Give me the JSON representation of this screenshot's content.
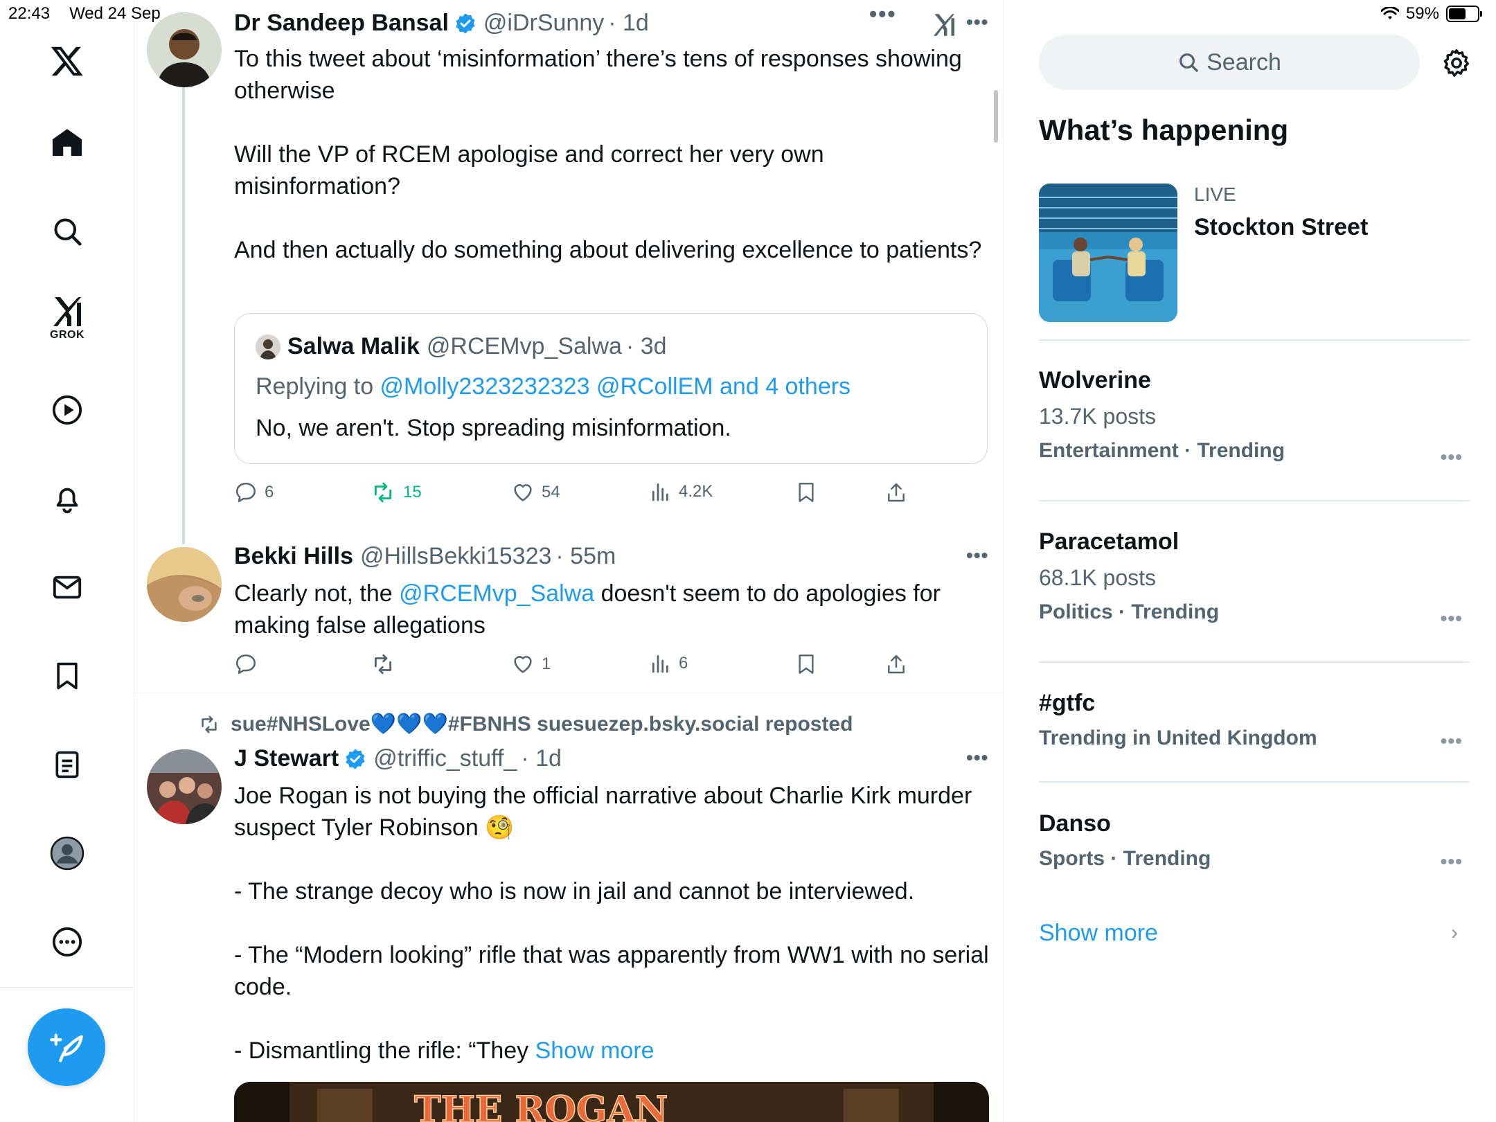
{
  "status": {
    "time": "22:43",
    "date": "Wed 24 Sep",
    "battery": "59%",
    "battery_level": 0.59
  },
  "nav": {
    "grok_label": "GROK",
    "icons": [
      "x-logo-icon",
      "home-icon",
      "search-icon",
      "grok-icon",
      "video-icon",
      "bell-icon",
      "mail-icon",
      "bookmark-icon",
      "lists-icon",
      "profile-icon",
      "more-icon",
      "compose-icon"
    ]
  },
  "tweets": [
    {
      "name": "Dr Sandeep Bansal",
      "handle": "@iDrSunny",
      "time": "· 1d",
      "verified": true,
      "text": "To this tweet about ‘misinformation’ there’s tens of responses showing otherwise\n\nWill the VP of RCEM apologise and correct her very own misinformation?\n\nAnd then actually do something about delivering excellence to patients?",
      "quote": {
        "name": "Salwa Malik",
        "handle": "@RCEMvp_Salwa",
        "time": "· 3d",
        "replying_prefix": "Replying to ",
        "replying_to": "@Molly2323232323 @RCollEM and 4 others",
        "text": "No, we aren't. Stop spreading misinformation."
      },
      "replies": "6",
      "reposts": "15",
      "likes": "54",
      "views": "4.2K"
    },
    {
      "name": "Bekki Hills",
      "handle": "@HillsBekki15323",
      "time": "· 55m",
      "text_before": "Clearly not, the ",
      "mention": "@RCEMvp_Salwa",
      "text_after": " doesn't seem to do apologies for\nmaking false allegations",
      "replies": "",
      "reposts": "",
      "likes": "1",
      "views": "6"
    },
    {
      "repost_by": "sue#NHSLove💙💙💙#FBNHS suesuezep.bsky.social reposted",
      "name": "J Stewart",
      "handle": "@triffic_stuff_",
      "time": "· 1d",
      "verified": true,
      "text": "Joe Rogan is not buying the official narrative about Charlie Kirk murder suspect Tyler Robinson 🧐\n\n- The strange decoy who is now in jail and cannot be interviewed.\n\n- The “Modern looking” rifle that was apparently from WW1 with no serial code.\n\n- Dismantling the rifle: “They ",
      "show_more": "Show more",
      "media_text": "THE ROGAN"
    }
  ],
  "sidebar": {
    "search_placeholder": "Search",
    "whats_happening": "What’s happening",
    "live": {
      "tag": "LIVE",
      "title": "Stockton Street"
    },
    "trends": [
      {
        "title": "Wolverine",
        "posts": "13.7K posts",
        "category": "Entertainment · Trending"
      },
      {
        "title": "Paracetamol",
        "posts": "68.1K posts",
        "category": "Politics · Trending"
      },
      {
        "title": "#gtfc",
        "category": "Trending in United Kingdom"
      },
      {
        "title": "Danso",
        "category": "Sports · Trending"
      }
    ],
    "show_more": "Show more"
  },
  "colors": {
    "accent": "#1d9bf0",
    "repost_green": "#00ba7c",
    "muted": "#536471"
  }
}
